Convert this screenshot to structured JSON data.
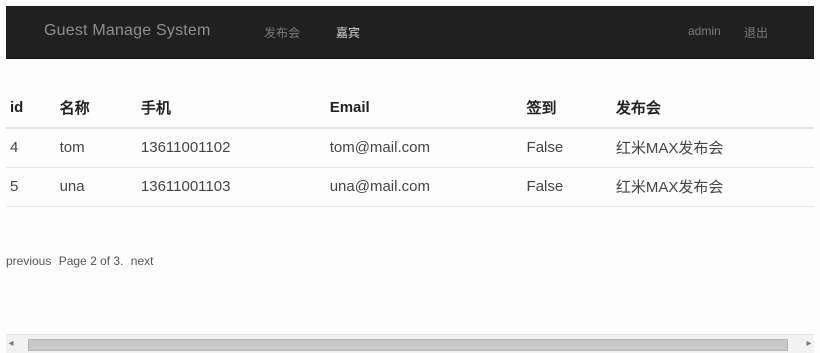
{
  "navbar": {
    "brand": "Guest Manage System",
    "links": [
      {
        "label": "发布会"
      },
      {
        "label": "嘉宾"
      }
    ],
    "user": "admin",
    "logout": "退出"
  },
  "table": {
    "headers": [
      "id",
      "名称",
      "手机",
      "Email",
      "签到",
      "发布会"
    ],
    "rows": [
      {
        "id": "4",
        "name": "tom",
        "phone": "13611001102",
        "email": "tom@mail.com",
        "sign": "False",
        "event": "红米MAX发布会"
      },
      {
        "id": "5",
        "name": "una",
        "phone": "13611001103",
        "email": "una@mail.com",
        "sign": "False",
        "event": "红米MAX发布会"
      }
    ]
  },
  "pagination": {
    "previous": "previous",
    "page_text": "Page 2 of 3.",
    "next": "next"
  },
  "colors": {
    "navbar_bg": "#202020",
    "navbar_text": "#9c9c9c",
    "active_link": "#d9d9d9",
    "table_text": "#444444"
  },
  "icons": {
    "scroll_left": "arrow-left-icon",
    "scroll_right": "arrow-right-icon"
  }
}
